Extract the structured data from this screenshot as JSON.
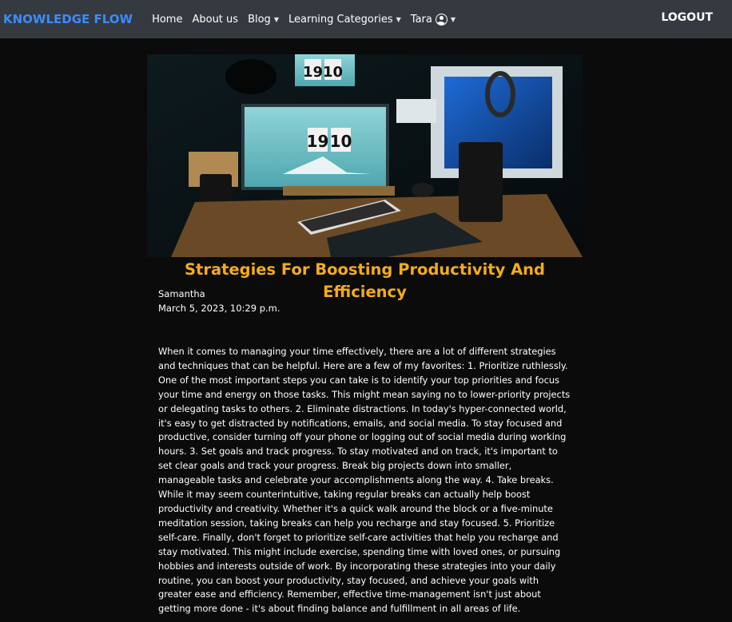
{
  "nav": {
    "brand": "KNOWLEDGE FLOW",
    "links": [
      {
        "label": "Home"
      },
      {
        "label": "About us"
      },
      {
        "label": "Blog"
      },
      {
        "label": "Learning Categories"
      },
      {
        "label": "Tara"
      }
    ],
    "logout": "LOGOUT"
  },
  "post": {
    "image_alt": "Desk setup with two monitors showing 19 10 clock",
    "clock_text": "19 10",
    "title": "Strategies For Boosting Productivity And Efficiency",
    "author": "Samantha",
    "date": "March 5, 2023, 10:29 p.m.",
    "body": "When it comes to managing your time effectively, there are a lot of different strategies and techniques that can be helpful. Here are a few of my favorites: 1. Prioritize ruthlessly. One of the most important steps you can take is to identify your top priorities and focus your time and energy on those tasks. This might mean saying no to lower-priority projects or delegating tasks to others. 2. Eliminate distractions. In today's hyper-connected world, it's easy to get distracted by notifications, emails, and social media. To stay focused and productive, consider turning off your phone or logging out of social media during working hours. 3. Set goals and track progress. To stay motivated and on track, it's important to set clear goals and track your progress. Break big projects down into smaller, manageable tasks and celebrate your accomplishments along the way. 4. Take breaks. While it may seem counterintuitive, taking regular breaks can actually help boost productivity and creativity. Whether it's a quick walk around the block or a five-minute meditation session, taking breaks can help you recharge and stay focused. 5. Prioritize self-care. Finally, don't forget to prioritize self-care activities that help you recharge and stay motivated. This might include exercise, spending time with loved ones, or pursuing hobbies and interests outside of work. By incorporating these strategies into your daily routine, you can boost your productivity, stay focused, and achieve your goals with greater ease and efficiency. Remember, effective time-management isn't just about getting more done - it's about finding balance and fulfillment in all areas of life."
  },
  "colors": {
    "brand": "#3d8bfd",
    "navbar": "#353a40",
    "title": "#f4ab1e",
    "background": "#0b0b0b"
  }
}
